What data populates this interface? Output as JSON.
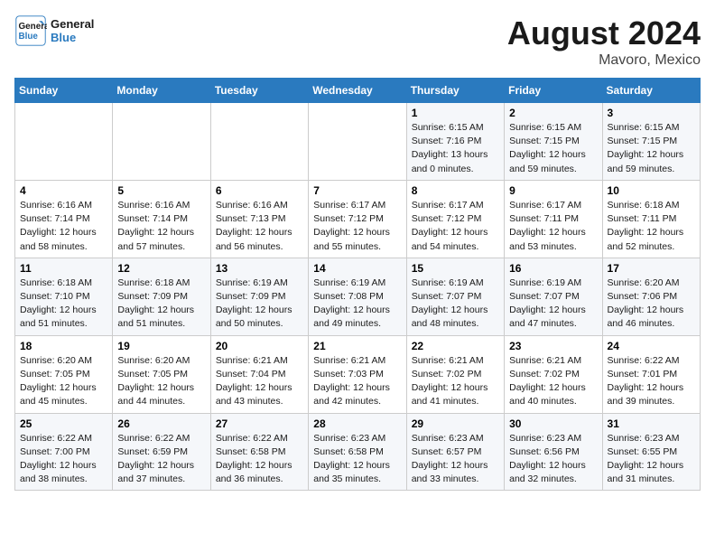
{
  "logo": {
    "line1": "General",
    "line2": "Blue"
  },
  "title": "August 2024",
  "subtitle": "Mavoro, Mexico",
  "days_of_week": [
    "Sunday",
    "Monday",
    "Tuesday",
    "Wednesday",
    "Thursday",
    "Friday",
    "Saturday"
  ],
  "weeks": [
    [
      {
        "day": "",
        "info": ""
      },
      {
        "day": "",
        "info": ""
      },
      {
        "day": "",
        "info": ""
      },
      {
        "day": "",
        "info": ""
      },
      {
        "day": "1",
        "info": "Sunrise: 6:15 AM\nSunset: 7:16 PM\nDaylight: 13 hours\nand 0 minutes."
      },
      {
        "day": "2",
        "info": "Sunrise: 6:15 AM\nSunset: 7:15 PM\nDaylight: 12 hours\nand 59 minutes."
      },
      {
        "day": "3",
        "info": "Sunrise: 6:15 AM\nSunset: 7:15 PM\nDaylight: 12 hours\nand 59 minutes."
      }
    ],
    [
      {
        "day": "4",
        "info": "Sunrise: 6:16 AM\nSunset: 7:14 PM\nDaylight: 12 hours\nand 58 minutes."
      },
      {
        "day": "5",
        "info": "Sunrise: 6:16 AM\nSunset: 7:14 PM\nDaylight: 12 hours\nand 57 minutes."
      },
      {
        "day": "6",
        "info": "Sunrise: 6:16 AM\nSunset: 7:13 PM\nDaylight: 12 hours\nand 56 minutes."
      },
      {
        "day": "7",
        "info": "Sunrise: 6:17 AM\nSunset: 7:12 PM\nDaylight: 12 hours\nand 55 minutes."
      },
      {
        "day": "8",
        "info": "Sunrise: 6:17 AM\nSunset: 7:12 PM\nDaylight: 12 hours\nand 54 minutes."
      },
      {
        "day": "9",
        "info": "Sunrise: 6:17 AM\nSunset: 7:11 PM\nDaylight: 12 hours\nand 53 minutes."
      },
      {
        "day": "10",
        "info": "Sunrise: 6:18 AM\nSunset: 7:11 PM\nDaylight: 12 hours\nand 52 minutes."
      }
    ],
    [
      {
        "day": "11",
        "info": "Sunrise: 6:18 AM\nSunset: 7:10 PM\nDaylight: 12 hours\nand 51 minutes."
      },
      {
        "day": "12",
        "info": "Sunrise: 6:18 AM\nSunset: 7:09 PM\nDaylight: 12 hours\nand 51 minutes."
      },
      {
        "day": "13",
        "info": "Sunrise: 6:19 AM\nSunset: 7:09 PM\nDaylight: 12 hours\nand 50 minutes."
      },
      {
        "day": "14",
        "info": "Sunrise: 6:19 AM\nSunset: 7:08 PM\nDaylight: 12 hours\nand 49 minutes."
      },
      {
        "day": "15",
        "info": "Sunrise: 6:19 AM\nSunset: 7:07 PM\nDaylight: 12 hours\nand 48 minutes."
      },
      {
        "day": "16",
        "info": "Sunrise: 6:19 AM\nSunset: 7:07 PM\nDaylight: 12 hours\nand 47 minutes."
      },
      {
        "day": "17",
        "info": "Sunrise: 6:20 AM\nSunset: 7:06 PM\nDaylight: 12 hours\nand 46 minutes."
      }
    ],
    [
      {
        "day": "18",
        "info": "Sunrise: 6:20 AM\nSunset: 7:05 PM\nDaylight: 12 hours\nand 45 minutes."
      },
      {
        "day": "19",
        "info": "Sunrise: 6:20 AM\nSunset: 7:05 PM\nDaylight: 12 hours\nand 44 minutes."
      },
      {
        "day": "20",
        "info": "Sunrise: 6:21 AM\nSunset: 7:04 PM\nDaylight: 12 hours\nand 43 minutes."
      },
      {
        "day": "21",
        "info": "Sunrise: 6:21 AM\nSunset: 7:03 PM\nDaylight: 12 hours\nand 42 minutes."
      },
      {
        "day": "22",
        "info": "Sunrise: 6:21 AM\nSunset: 7:02 PM\nDaylight: 12 hours\nand 41 minutes."
      },
      {
        "day": "23",
        "info": "Sunrise: 6:21 AM\nSunset: 7:02 PM\nDaylight: 12 hours\nand 40 minutes."
      },
      {
        "day": "24",
        "info": "Sunrise: 6:22 AM\nSunset: 7:01 PM\nDaylight: 12 hours\nand 39 minutes."
      }
    ],
    [
      {
        "day": "25",
        "info": "Sunrise: 6:22 AM\nSunset: 7:00 PM\nDaylight: 12 hours\nand 38 minutes."
      },
      {
        "day": "26",
        "info": "Sunrise: 6:22 AM\nSunset: 6:59 PM\nDaylight: 12 hours\nand 37 minutes."
      },
      {
        "day": "27",
        "info": "Sunrise: 6:22 AM\nSunset: 6:58 PM\nDaylight: 12 hours\nand 36 minutes."
      },
      {
        "day": "28",
        "info": "Sunrise: 6:23 AM\nSunset: 6:58 PM\nDaylight: 12 hours\nand 35 minutes."
      },
      {
        "day": "29",
        "info": "Sunrise: 6:23 AM\nSunset: 6:57 PM\nDaylight: 12 hours\nand 33 minutes."
      },
      {
        "day": "30",
        "info": "Sunrise: 6:23 AM\nSunset: 6:56 PM\nDaylight: 12 hours\nand 32 minutes."
      },
      {
        "day": "31",
        "info": "Sunrise: 6:23 AM\nSunset: 6:55 PM\nDaylight: 12 hours\nand 31 minutes."
      }
    ]
  ]
}
